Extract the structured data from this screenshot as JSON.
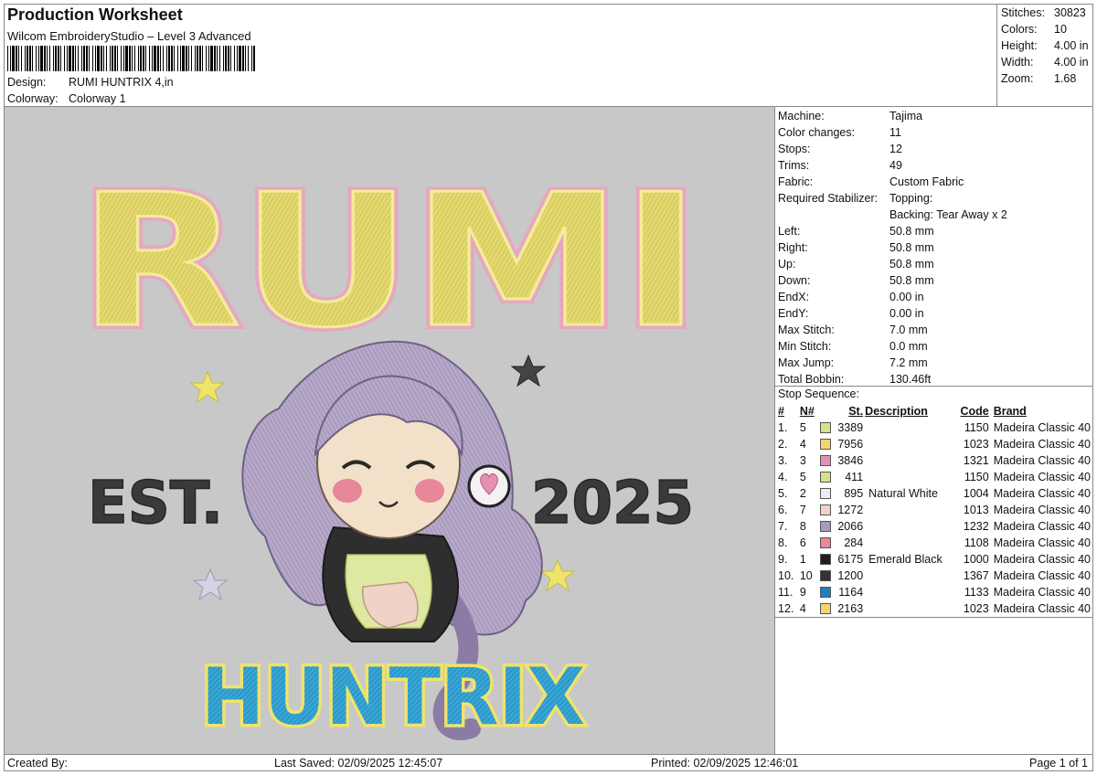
{
  "header": {
    "title": "Production Worksheet",
    "software": "Wilcom EmbroideryStudio – Level 3 Advanced",
    "design_label": "Design:",
    "design_value": "RUMI HUNTRIX 4,in",
    "colorway_label": "Colorway:",
    "colorway_value": "Colorway 1"
  },
  "stats": [
    {
      "label": "Stitches:",
      "value": "30823"
    },
    {
      "label": "Colors:",
      "value": "10"
    },
    {
      "label": "Height:",
      "value": "4.00 in"
    },
    {
      "label": "Width:",
      "value": "4.00 in"
    },
    {
      "label": "Zoom:",
      "value": "1.68"
    }
  ],
  "machine_info": [
    {
      "label": "Machine:",
      "value": "Tajima"
    },
    {
      "label": "Color changes:",
      "value": "11"
    },
    {
      "label": "Stops:",
      "value": "12"
    },
    {
      "label": "Trims:",
      "value": "49"
    },
    {
      "label": "Fabric:",
      "value": "Custom Fabric"
    },
    {
      "label": "Required Stabilizer:",
      "value": "Topping:",
      "value2": "Backing: Tear Away x 2"
    },
    {
      "label": "Left:",
      "value": "50.8 mm"
    },
    {
      "label": "Right:",
      "value": "50.8 mm"
    },
    {
      "label": "Up:",
      "value": "50.8 mm"
    },
    {
      "label": "Down:",
      "value": "50.8 mm"
    },
    {
      "label": "EndX:",
      "value": "0.00 in"
    },
    {
      "label": "EndY:",
      "value": "0.00 in"
    },
    {
      "label": "Max Stitch:",
      "value": "7.0 mm"
    },
    {
      "label": "Min Stitch:",
      "value": "0.0 mm"
    },
    {
      "label": "Max Jump:",
      "value": "7.2 mm"
    },
    {
      "label": "Total Bobbin:",
      "value": "130.46ft"
    }
  ],
  "stop_sequence": {
    "title": "Stop Sequence:",
    "columns": {
      "num": "#",
      "n": "N#",
      "st": "St.",
      "desc": "Description",
      "code": "Code",
      "brand": "Brand"
    },
    "rows": [
      {
        "num": "1.",
        "n": "5",
        "st": "3389",
        "desc": "",
        "code": "1150",
        "brand": "Madeira Classic 40",
        "color": "#d7e08a"
      },
      {
        "num": "2.",
        "n": "4",
        "st": "7956",
        "desc": "",
        "code": "1023",
        "brand": "Madeira Classic 40",
        "color": "#f3d66a"
      },
      {
        "num": "3.",
        "n": "3",
        "st": "3846",
        "desc": "",
        "code": "1321",
        "brand": "Madeira Classic 40",
        "color": "#e58fb2"
      },
      {
        "num": "4.",
        "n": "5",
        "st": "411",
        "desc": "",
        "code": "1150",
        "brand": "Madeira Classic 40",
        "color": "#d7e08a"
      },
      {
        "num": "5.",
        "n": "2",
        "st": "895",
        "desc": "Natural White",
        "code": "1004",
        "brand": "Madeira Classic 40",
        "color": "#eeeaf0"
      },
      {
        "num": "6.",
        "n": "7",
        "st": "1272",
        "desc": "",
        "code": "1013",
        "brand": "Madeira Classic 40",
        "color": "#f1d2c6"
      },
      {
        "num": "7.",
        "n": "8",
        "st": "2066",
        "desc": "",
        "code": "1232",
        "brand": "Madeira Classic 40",
        "color": "#a99ac0"
      },
      {
        "num": "8.",
        "n": "6",
        "st": "284",
        "desc": "",
        "code": "1108",
        "brand": "Madeira Classic 40",
        "color": "#e8869a"
      },
      {
        "num": "9.",
        "n": "1",
        "st": "6175",
        "desc": "Emerald Black",
        "code": "1000",
        "brand": "Madeira Classic 40",
        "color": "#1e1e1e"
      },
      {
        "num": "10.",
        "n": "10",
        "st": "1200",
        "desc": "",
        "code": "1367",
        "brand": "Madeira Classic 40",
        "color": "#333333"
      },
      {
        "num": "11.",
        "n": "9",
        "st": "1164",
        "desc": "",
        "code": "1133",
        "brand": "Madeira Classic 40",
        "color": "#1f7fc0"
      },
      {
        "num": "12.",
        "n": "4",
        "st": "2163",
        "desc": "",
        "code": "1023",
        "brand": "Madeira Classic 40",
        "color": "#f3d66a"
      }
    ]
  },
  "design_text": {
    "top": "RUMI",
    "est": "EST.",
    "year": "2025",
    "bottom": "HUNTRIX"
  },
  "footer": {
    "created_by": "Created By:",
    "last_saved": "Last Saved: 02/09/2025 12:45:07",
    "printed": "Printed: 02/09/2025 12:46:01",
    "page": "Page 1 of 1"
  }
}
